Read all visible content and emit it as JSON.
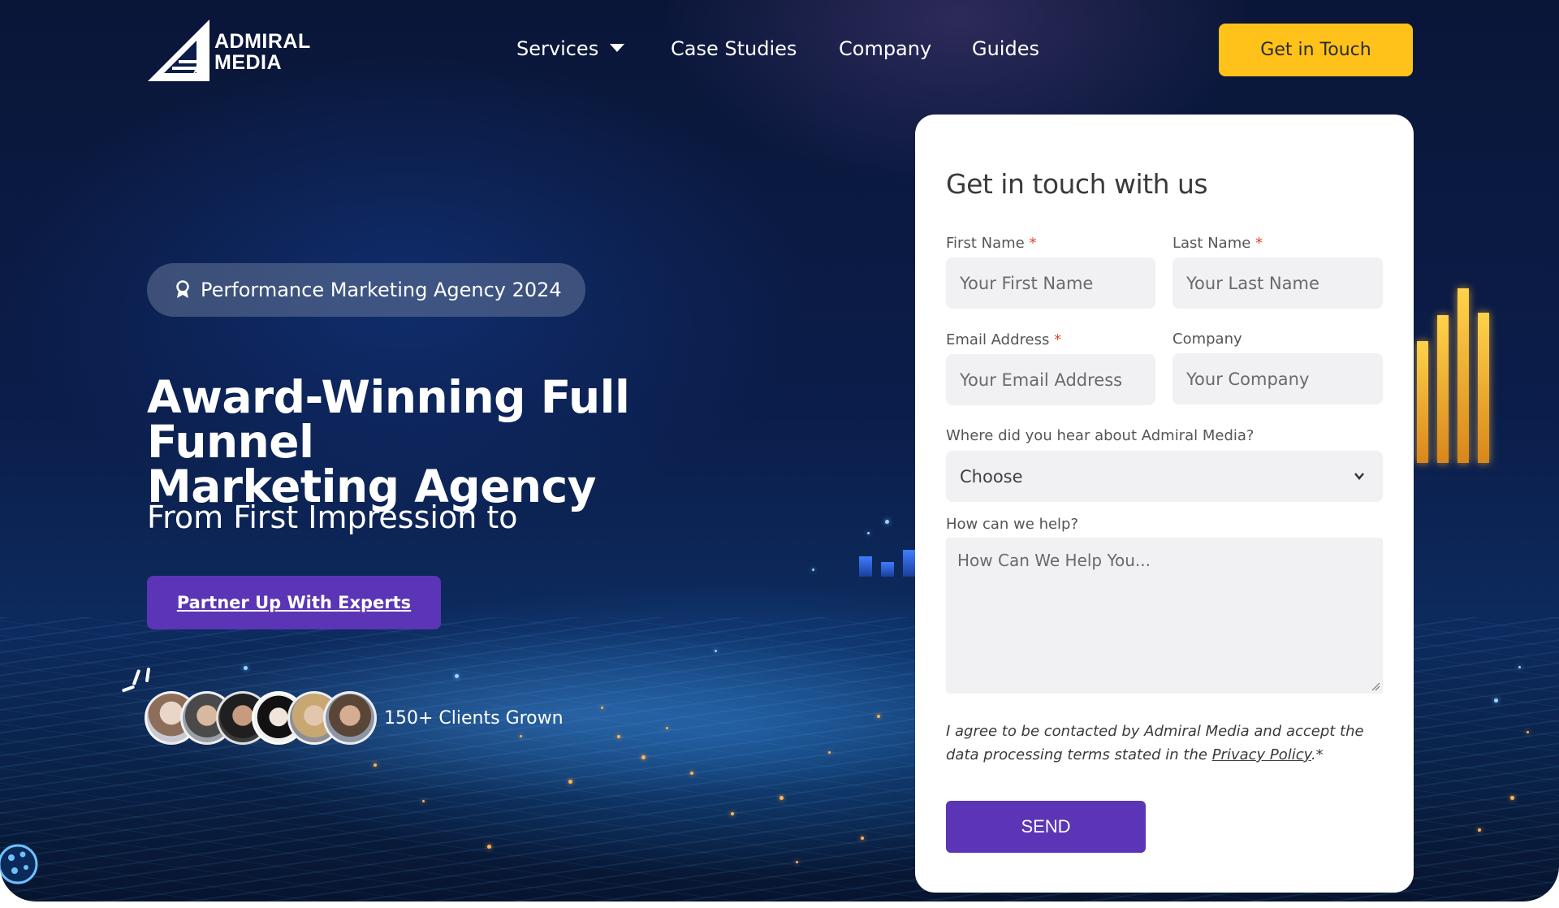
{
  "brand": {
    "name_line1": "ADMIRAL",
    "name_line2": "MEDIA"
  },
  "nav": {
    "services": "Services",
    "case_studies": "Case Studies",
    "company": "Company",
    "guides": "Guides",
    "cta": "Get in Touch"
  },
  "hero": {
    "badge": "Performance Marketing Agency 2024",
    "title_line1": "Award-Winning Full Funnel",
    "title_line2": "Marketing Agency",
    "subtitle": "From First Impression to",
    "cta": "Partner Up With Experts",
    "clients": "150+ Clients Grown"
  },
  "form": {
    "title": "Get in touch with us",
    "first_name_label": "First Name",
    "first_name_placeholder": "Your First Name",
    "last_name_label": "Last Name",
    "last_name_placeholder": "Your Last Name",
    "email_label": "Email Address",
    "email_placeholder": "Your Email Address",
    "company_label": "Company",
    "company_placeholder": "Your Company",
    "source_label": "Where did you hear about Admiral Media?",
    "source_value": "Choose",
    "help_label": "How can we help?",
    "help_placeholder": "How Can We Help You...",
    "required_mark": "*",
    "consent_text": "I agree to be contacted by Admiral Media and accept the data processing terms stated in the ",
    "privacy_link": "Privacy Policy",
    "consent_end": ".*",
    "send": "SEND"
  },
  "colors": {
    "accent_yellow": "#ffc21a",
    "accent_purple": "#5b35b5",
    "background_navy": "#0b1d4a"
  }
}
